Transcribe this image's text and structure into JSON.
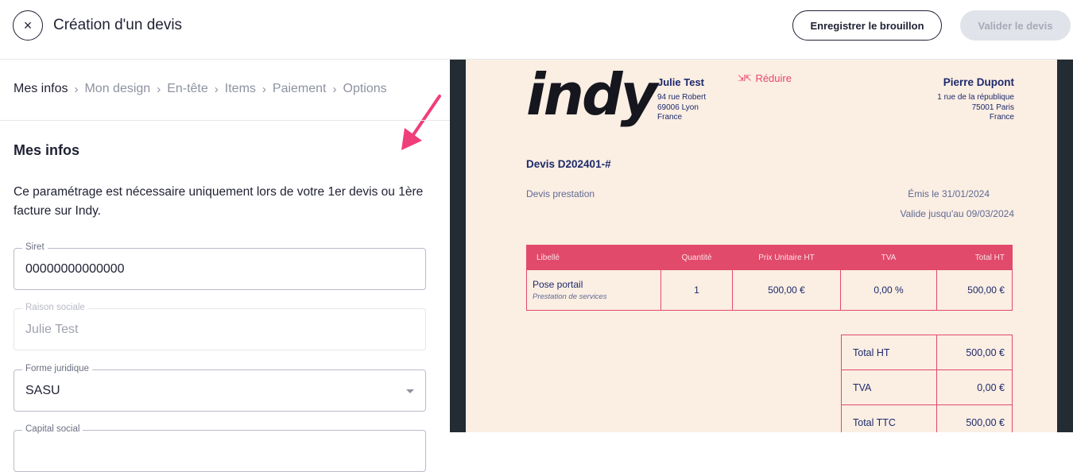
{
  "header": {
    "title": "Création d'un devis",
    "close_icon": "×",
    "draft_button": "Enregistrer le brouillon",
    "validate_button": "Valider le devis"
  },
  "steps": [
    {
      "label": "Mes infos",
      "active": true
    },
    {
      "label": "Mon design",
      "active": false
    },
    {
      "label": "En-tête",
      "active": false
    },
    {
      "label": "Items",
      "active": false
    },
    {
      "label": "Paiement",
      "active": false
    },
    {
      "label": "Options",
      "active": false
    }
  ],
  "step_separator": "›",
  "form": {
    "section_title": "Mes infos",
    "description": "Ce paramétrage est nécessaire uniquement lors de votre 1er devis ou 1ère facture sur Indy.",
    "fields": {
      "siret": {
        "label": "Siret",
        "value": "00000000000000"
      },
      "raison": {
        "label": "Raison sociale",
        "value": "Julie Test"
      },
      "forme": {
        "label": "Forme juridique",
        "value": "SASU"
      },
      "capital": {
        "label": "Capital social",
        "value": ""
      }
    }
  },
  "annotation_color": "#f03e7a",
  "preview": {
    "logo": "indy",
    "reduce_label": "Réduire",
    "seller": {
      "name": "Julie Test",
      "line1": "94 rue Robert",
      "line2": "69006 Lyon",
      "line3": "France"
    },
    "client": {
      "name": "Pierre Dupont",
      "line1": "1 rue de la république",
      "line2": "75001 Paris",
      "line3": "France"
    },
    "quote_number": "Devis D202401-#",
    "quote_type": "Devis prestation",
    "issued": "Émis le 31/01/2024",
    "valid_until": "Valide jusqu'au 09/03/2024",
    "table": {
      "headers": {
        "label": "Libellé",
        "qty": "Quantité",
        "unit": "Prix Unitaire HT",
        "vat": "TVA",
        "total": "Total HT"
      },
      "row": {
        "label": "Pose portail",
        "sub": "Prestation de services",
        "qty": "1",
        "unit": "500,00 €",
        "vat": "0,00 %",
        "total": "500,00 €"
      }
    },
    "totals": [
      {
        "label": "Total HT",
        "value": "500,00 €"
      },
      {
        "label": "TVA",
        "value": "0,00 €"
      },
      {
        "label": "Total TTC",
        "value": "500,00 €"
      }
    ],
    "colors": {
      "accent": "#e14a6b",
      "navy": "#1c2a6b",
      "paper": "#fbeee3",
      "frame": "#232b33"
    }
  }
}
